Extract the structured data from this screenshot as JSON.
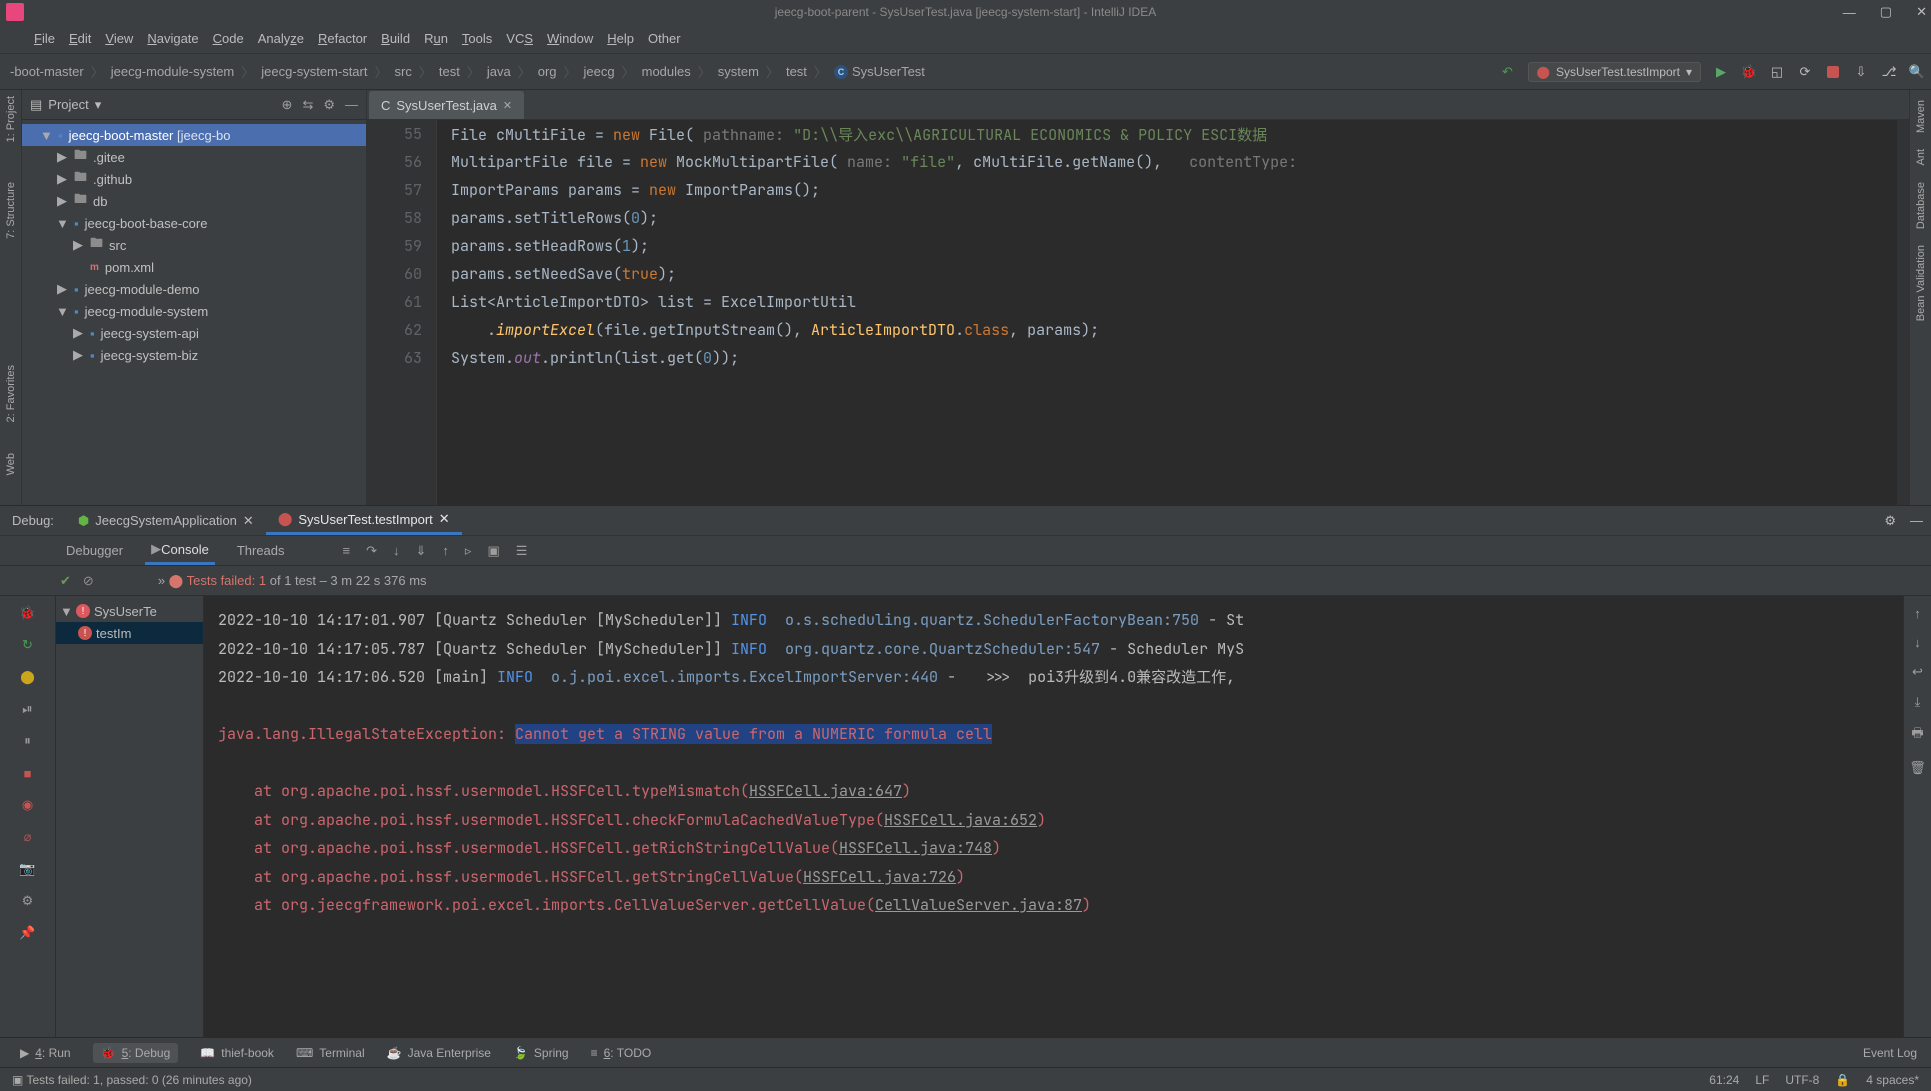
{
  "window": {
    "title": "jeecg-boot-parent - SysUserTest.java [jeecg-system-start] - IntelliJ IDEA"
  },
  "menu": {
    "items": [
      "File",
      "Edit",
      "View",
      "Navigate",
      "Code",
      "Analyze",
      "Refactor",
      "Build",
      "Run",
      "Tools",
      "VCS",
      "Window",
      "Help",
      "Other"
    ]
  },
  "breadcrumbs": [
    "-boot-master",
    "jeecg-module-system",
    "jeecg-system-start",
    "src",
    "test",
    "java",
    "org",
    "jeecg",
    "modules",
    "system",
    "test",
    "SysUserTest"
  ],
  "run_config": {
    "label": "SysUserTest.testImport"
  },
  "project": {
    "title": "Project",
    "tree": [
      {
        "indent": 1,
        "arrow": "▼",
        "icon": "module",
        "label": "jeecg-boot-master",
        "suffix": "[jeecg-bo",
        "sel": true
      },
      {
        "indent": 2,
        "arrow": "▶",
        "icon": "folder",
        "label": ".gitee"
      },
      {
        "indent": 2,
        "arrow": "▶",
        "icon": "folder",
        "label": ".github"
      },
      {
        "indent": 2,
        "arrow": "▶",
        "icon": "folder",
        "label": "db"
      },
      {
        "indent": 2,
        "arrow": "▼",
        "icon": "module",
        "label": "jeecg-boot-base-core"
      },
      {
        "indent": 3,
        "arrow": "▶",
        "icon": "folder",
        "label": "src"
      },
      {
        "indent": 3,
        "arrow": "",
        "icon": "pom",
        "label": "pom.xml"
      },
      {
        "indent": 2,
        "arrow": "▶",
        "icon": "module",
        "label": "jeecg-module-demo"
      },
      {
        "indent": 2,
        "arrow": "▼",
        "icon": "module",
        "label": "jeecg-module-system"
      },
      {
        "indent": 3,
        "arrow": "▶",
        "icon": "module",
        "label": "jeecg-system-api"
      },
      {
        "indent": 3,
        "arrow": "▶",
        "icon": "module",
        "label": "jeecg-system-biz"
      }
    ]
  },
  "editor": {
    "tab": "SysUserTest.java",
    "gutter": [
      "55",
      "56",
      "57",
      "58",
      "59",
      "60",
      "61",
      "62",
      "63"
    ],
    "lines": {
      "l55_a": "File cMultiFile = ",
      "l55_new": "new",
      "l55_b": " File( ",
      "l55_hint": "pathname: ",
      "l55_str": "\"D:\\\\导入exc\\\\AGRICULTURAL ECONOMICS & POLICY ESCI数据",
      "l56_a": "MultipartFile file = ",
      "l56_new": "new",
      "l56_b": " MockMultipartFile( ",
      "l56_hint": "name: ",
      "l56_str": "\"file\"",
      "l56_c": ", cMultiFile.getName(),   ",
      "l56_hint2": "contentType:",
      "l57_a": "ImportParams params = ",
      "l57_new": "new",
      "l57_b": " ImportParams();",
      "l58": "params.setTitleRows(",
      "l58_num": "0",
      "l58_b": ");",
      "l59": "params.setHeadRows(",
      "l59_num": "1",
      "l59_b": ");",
      "l60": "params.setNeedSave(",
      "l60_kw": "true",
      "l60_b": ");",
      "l61_a": "List<ArticleImportDTO> list = ExcelImportUtil",
      "l62_a": "    .",
      "l62_m": "importExcel",
      "l62_b": "(file.getInputStream(), ",
      "l62_cls": "ArticleImportDTO",
      "l62_c": ".",
      "l62_kw": "class",
      "l62_d": ", params);",
      "l63_a": "System.",
      "l63_out": "out",
      "l63_b": ".println(list.get(",
      "l63_num": "0",
      "l63_c": "));"
    }
  },
  "debug": {
    "title": "Debug:",
    "tabs": [
      {
        "label": "JeecgSystemApplication",
        "active": false
      },
      {
        "label": "SysUserTest.testImport",
        "active": true
      }
    ],
    "inner_tabs": {
      "debugger": "Debugger",
      "console": "Console",
      "threads": "Threads"
    },
    "status": {
      "prefix": "»",
      "fail_label": "Tests failed: 1",
      "rest": " of 1 test – 3 m 22 s 376 ms"
    },
    "test_tree": [
      {
        "label": "SysUserTe",
        "sel": false
      },
      {
        "label": "testIm",
        "sel": true
      }
    ],
    "console": [
      {
        "text": "2022-10-10 14:17:01.907 [Quartz Scheduler [MyScheduler]] ",
        "lvl": "INFO",
        "logger": "o.s.scheduling.quartz.SchedulerFactoryBean:750",
        "after": " - St"
      },
      {
        "text": "2022-10-10 14:17:05.787 [Quartz Scheduler [MyScheduler]] ",
        "lvl": "INFO",
        "logger": "org.quartz.core.QuartzScheduler:547",
        "after": " - Scheduler MyS"
      },
      {
        "text": "2022-10-10 14:17:06.520 [main] ",
        "lvl": "INFO",
        "logger": "o.j.poi.excel.imports.ExcelImportServer:440",
        "after": " -   >>>  poi3升级到4.0兼容改造工作,"
      }
    ],
    "exception": {
      "head": "java.lang.IllegalStateException: ",
      "msg": "Cannot get a STRING value from a NUMERIC formula cell",
      "stack": [
        {
          "at": "    at org.apache.poi.hssf.usermodel.HSSFCell.typeMismatch(",
          "link": "HSSFCell.java:647",
          "tail": ")"
        },
        {
          "at": "    at org.apache.poi.hssf.usermodel.HSSFCell.checkFormulaCachedValueType(",
          "link": "HSSFCell.java:652",
          "tail": ")"
        },
        {
          "at": "    at org.apache.poi.hssf.usermodel.HSSFCell.getRichStringCellValue(",
          "link": "HSSFCell.java:748",
          "tail": ")"
        },
        {
          "at": "    at org.apache.poi.hssf.usermodel.HSSFCell.getStringCellValue(",
          "link": "HSSFCell.java:726",
          "tail": ")"
        },
        {
          "at": "    at org.jeecgframework.poi.excel.imports.CellValueServer.getCellValue(",
          "link": "CellValueServer.java:87",
          "tail": ")"
        }
      ]
    }
  },
  "bottom": [
    {
      "label": "4: Run",
      "active": false,
      "u": "4"
    },
    {
      "label": "5: Debug",
      "active": true,
      "u": "5"
    },
    {
      "label": "thief-book",
      "active": false
    },
    {
      "label": "Terminal",
      "active": false
    },
    {
      "label": "Java Enterprise",
      "active": false
    },
    {
      "label": "Spring",
      "active": false
    },
    {
      "label": "6: TODO",
      "active": false,
      "u": "6"
    }
  ],
  "event_log": "Event Log",
  "status": {
    "msg": "Tests failed: 1, passed: 0 (26 minutes ago)",
    "pos": "61:24",
    "lf": "LF",
    "enc": "UTF-8",
    "spaces": "4 spaces*"
  },
  "right_tools": [
    "Maven",
    "Ant",
    "Database",
    "Bean Validation"
  ]
}
